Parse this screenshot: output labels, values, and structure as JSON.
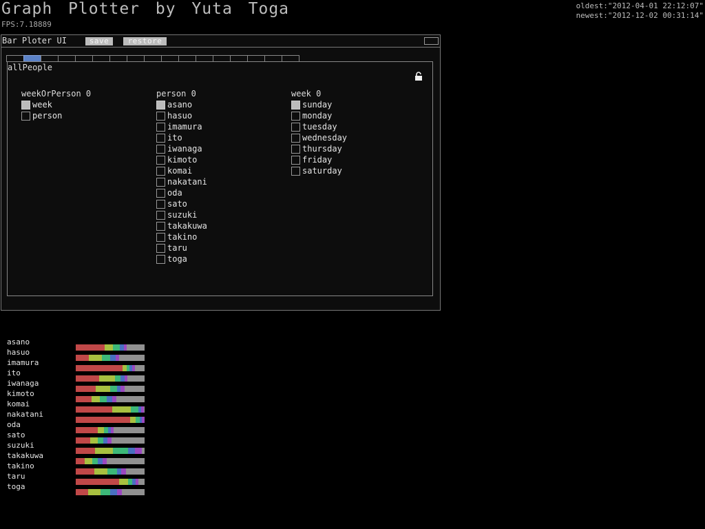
{
  "header": {
    "title": "Graph Plotter by Yuta Toga",
    "fps": "FPS:7.18889",
    "oldest": "oldest:\"2012-04-01 22:12:07\"",
    "newest": "newest:\"2012-12-02 00:31:14\""
  },
  "panel": {
    "title": "Bar Ploter UI",
    "save_label": "save",
    "restore_label": "restore",
    "tab_count": 17,
    "active_tab": 1,
    "group_title": "allPeople",
    "groups": [
      {
        "header": "weekOrPerson 0",
        "items": [
          {
            "label": "week",
            "checked": true
          },
          {
            "label": "person",
            "checked": false
          }
        ]
      },
      {
        "header": "person 0",
        "items": [
          {
            "label": "asano",
            "checked": true
          },
          {
            "label": "hasuo",
            "checked": false
          },
          {
            "label": "imamura",
            "checked": false
          },
          {
            "label": "ito",
            "checked": false
          },
          {
            "label": "iwanaga",
            "checked": false
          },
          {
            "label": "kimoto",
            "checked": false
          },
          {
            "label": "komai",
            "checked": false
          },
          {
            "label": "nakatani",
            "checked": false
          },
          {
            "label": "oda",
            "checked": false
          },
          {
            "label": "sato",
            "checked": false
          },
          {
            "label": "suzuki",
            "checked": false
          },
          {
            "label": "takakuwa",
            "checked": false
          },
          {
            "label": "takino",
            "checked": false
          },
          {
            "label": "taru",
            "checked": false
          },
          {
            "label": "toga",
            "checked": false
          }
        ]
      },
      {
        "header": "week 0",
        "items": [
          {
            "label": "sunday",
            "checked": true
          },
          {
            "label": "monday",
            "checked": false
          },
          {
            "label": "tuesday",
            "checked": false
          },
          {
            "label": "wednesday",
            "checked": false
          },
          {
            "label": "thursday",
            "checked": false
          },
          {
            "label": "friday",
            "checked": false
          },
          {
            "label": "saturday",
            "checked": false
          }
        ]
      }
    ]
  },
  "colors": {
    "background": "#000000",
    "accent_tab": "#5b82c7",
    "segments": [
      "#c04848",
      "#a8c040",
      "#3cb878",
      "#4870c0",
      "#9a48c0",
      "#909090"
    ]
  },
  "chart_data": {
    "type": "bar",
    "orientation": "horizontal",
    "stacked": true,
    "categories": [
      "asano",
      "hasuo",
      "imamura",
      "ito",
      "iwanaga",
      "kimoto",
      "komai",
      "nakatani",
      "oda",
      "sato",
      "suzuki",
      "takakuwa",
      "takino",
      "taru",
      "toga"
    ],
    "series": [
      {
        "values": [
          42,
          19,
          68,
          34,
          29,
          23,
          53,
          80,
          32,
          21,
          28,
          13,
          27,
          63,
          18
        ]
      },
      {
        "values": [
          12,
          19,
          6,
          23,
          21,
          12,
          27,
          8,
          9,
          11,
          26,
          11,
          19,
          13,
          18
        ]
      },
      {
        "values": [
          10,
          12,
          4,
          8,
          10,
          10,
          11,
          6,
          6,
          8,
          22,
          8,
          14,
          6,
          14
        ]
      },
      {
        "values": [
          6,
          8,
          4,
          6,
          5,
          8,
          4,
          3,
          4,
          6,
          10,
          7,
          6,
          5,
          10
        ]
      },
      {
        "values": [
          4,
          5,
          4,
          4,
          6,
          6,
          4,
          4,
          4,
          6,
          10,
          6,
          7,
          4,
          7
        ]
      },
      {
        "values": [
          26,
          37,
          14,
          25,
          29,
          41,
          1,
          0,
          45,
          48,
          4,
          55,
          27,
          9,
          33
        ]
      }
    ]
  }
}
